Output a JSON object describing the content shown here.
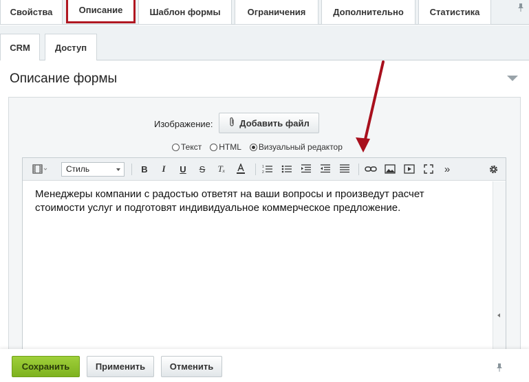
{
  "tabs": [
    {
      "label": "Свойства",
      "active": false
    },
    {
      "label": "Описание",
      "active": true
    },
    {
      "label": "Шаблон формы",
      "active": false
    },
    {
      "label": "Ограничения",
      "active": false
    },
    {
      "label": "Дополнительно",
      "active": false
    },
    {
      "label": "Статистика",
      "active": false
    }
  ],
  "subtabs": [
    {
      "label": "CRM"
    },
    {
      "label": "Доступ"
    }
  ],
  "section": {
    "title": "Описание формы"
  },
  "image": {
    "label": "Изображение:",
    "button_label": "Добавить файл"
  },
  "modes": [
    {
      "label": "Текст",
      "selected": false
    },
    {
      "label": "HTML",
      "selected": false
    },
    {
      "label": "Визуальный редактор",
      "selected": true
    }
  ],
  "toolbar": {
    "style_label": "Стиль"
  },
  "editor": {
    "content": "Менеджеры компании с радостью ответят на ваши вопросы и произведут расчет стоимости услуг и подготовят индивидуальное коммерческое предложение."
  },
  "footer": {
    "save_label": "Сохранить",
    "apply_label": "Применить",
    "cancel_label": "Отменить"
  },
  "colors": {
    "accent_red": "#b01721",
    "save_green": "#8cc22a"
  },
  "icons": [
    "pin-icon",
    "paperclip-icon",
    "media-icon",
    "bold-icon",
    "italic-icon",
    "underline-icon",
    "strikethrough-icon",
    "clear-format-icon",
    "font-color-icon",
    "ordered-list-icon",
    "unordered-list-icon",
    "outdent-icon",
    "indent-icon",
    "align-icon",
    "link-icon",
    "image-icon",
    "video-icon",
    "fullscreen-icon",
    "more-icon",
    "settings-icon"
  ]
}
